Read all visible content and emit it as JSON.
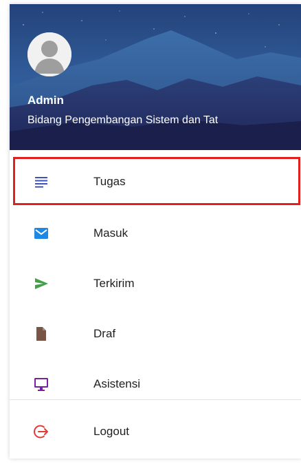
{
  "drawer": {
    "header": {
      "user_name": "Admin",
      "user_unit": "Bidang Pengembangan Sistem dan Tat",
      "avatar_icon": "person-icon",
      "background": "night-mountain-sky"
    },
    "menu": {
      "items": [
        {
          "label": "Tugas",
          "icon": "list-lines-icon",
          "icon_color": "#3f51b5",
          "selected": true
        },
        {
          "label": "Masuk",
          "icon": "mail-icon",
          "icon_color": "#1e88e5",
          "selected": false
        },
        {
          "label": "Terkirim",
          "icon": "send-icon",
          "icon_color": "#43a047",
          "selected": false
        },
        {
          "label": "Draf",
          "icon": "document-icon",
          "icon_color": "#795548",
          "selected": false
        },
        {
          "label": "Asistensi",
          "icon": "monitor-icon",
          "icon_color": "#7b1fa2",
          "selected": false
        }
      ],
      "selected_outline_color": "#e0201f"
    },
    "logout": {
      "label": "Logout",
      "icon": "logout-icon",
      "icon_color": "#e53935"
    }
  }
}
